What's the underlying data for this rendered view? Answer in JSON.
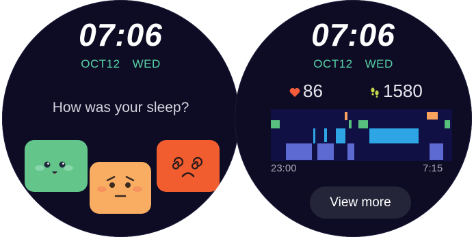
{
  "left_screen": {
    "time": "07:06",
    "date": "OCT12",
    "day": "WED",
    "question": "How was your sleep?",
    "moods": [
      {
        "name": "good",
        "color": "#64c58a"
      },
      {
        "name": "okay",
        "color": "#f9ad63"
      },
      {
        "name": "bad",
        "color": "#f15d2f"
      }
    ]
  },
  "right_screen": {
    "time": "07:06",
    "date": "OCT12",
    "day": "WED",
    "heart_rate": "86",
    "heart_icon": "heart-icon",
    "steps": "1580",
    "steps_icon": "footsteps-icon",
    "sleep_start": "23:00",
    "sleep_end": "7:15",
    "view_more_label": "View more"
  },
  "colors": {
    "watch_bg": "#0d0c24",
    "accent_green": "#58d3a6",
    "stage_awake": "#f9a25e",
    "stage_rem": "#58c07e",
    "stage_light": "#2ea6e6",
    "stage_deep": "#5d6ad2",
    "heart": "#f15d3b"
  }
}
